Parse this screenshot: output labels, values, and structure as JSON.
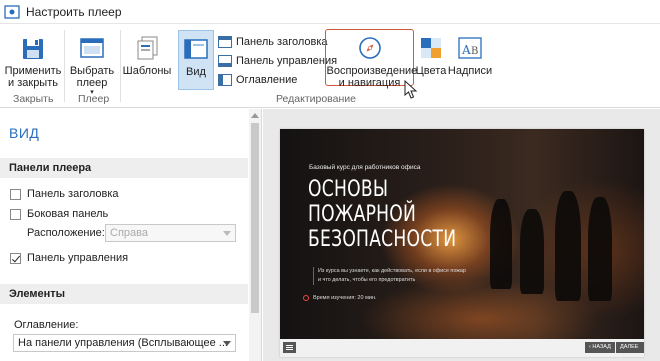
{
  "window": {
    "title": "Настроить плеер"
  },
  "ribbon": {
    "apply_label": "Применить и закрыть",
    "select_player_label": "Выбрать плеер",
    "templates_label": "Шаблоны",
    "view_label": "Вид",
    "title_panel_label": "Панель заголовка",
    "control_panel_label": "Панель управления",
    "toc_label": "Оглавление",
    "playback_label": "Воспроизведение и навигация",
    "colors_label": "Цвета",
    "captions_label": "Надписи",
    "groups": {
      "close": "Закрыть",
      "player": "Плеер",
      "edit": "Редактирование"
    }
  },
  "panel": {
    "title": "ВИД",
    "player_panels_header": "Панели плеера",
    "title_panel": "Панель заголовка",
    "sidebar": "Боковая панель",
    "location_label": "Расположение:",
    "location_value": "Справа",
    "control_panel": "Панель управления",
    "elements_header": "Элементы",
    "toc_label": "Оглавление:",
    "toc_value": "На панели управления (Всплывающее ..."
  },
  "slide": {
    "subtitle": "Базовый курс для работников офиса",
    "title_line1": "ОСНОВЫ",
    "title_line2": "ПОЖАРНОЙ",
    "title_line3": "БЕЗОПАСНОСТИ",
    "desc_line1": "Из курса вы узнаете, как действовать, если в офисе пожар",
    "desc_line2": "и что делать, чтобы его предотвратить",
    "time": "Время изучения: 20 мин.",
    "prev": "‹ НАЗАД",
    "next": "ДАЛЕЕ ›"
  },
  "colors": {
    "accent": "#2a6ebb",
    "highlight_border": "#d35a3a",
    "view_active": "#cfe3f5"
  }
}
